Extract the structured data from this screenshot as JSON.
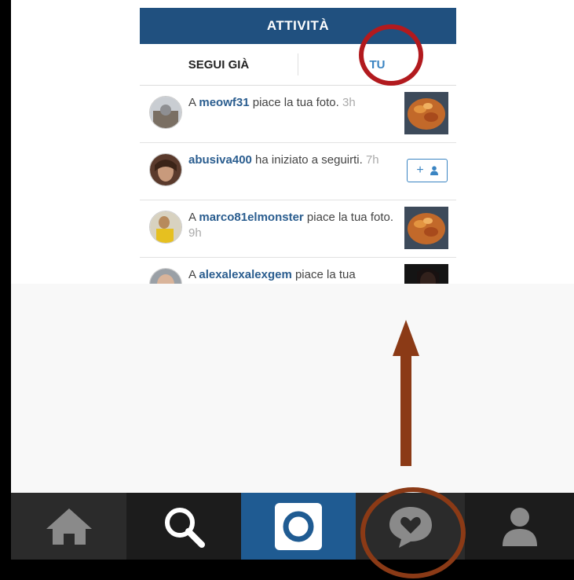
{
  "header": {
    "title": "ATTIVITÀ"
  },
  "tabs": [
    {
      "label": "SEGUI GIÀ"
    },
    {
      "label": "TU"
    }
  ],
  "feed": [
    {
      "prefix": "A ",
      "user": "meowf31",
      "action": " piace la tua foto. ",
      "time": "3h",
      "right": "photo"
    },
    {
      "prefix": "",
      "user": "abusiva400",
      "action": " ha iniziato a seguirti. ",
      "time": "7h",
      "right": "follow"
    },
    {
      "prefix": "A ",
      "user": "marco81elmonster",
      "action": " piace la tua foto. ",
      "time": "9h",
      "right": "photo"
    },
    {
      "prefix": "A ",
      "user": "alexalexalexgem",
      "action": " piace la tua",
      "time": "",
      "right": "photo-dark"
    }
  ],
  "follow_button": {
    "plus": "+",
    "icon": "person-icon"
  },
  "tabbar": {
    "items": [
      "home-icon",
      "search-icon",
      "camera-icon",
      "activity-heart-icon",
      "profile-icon"
    ],
    "selected": "camera-icon"
  },
  "colors": {
    "header": "#20507f",
    "link": "#2a5d8f",
    "active_tab": "#3a84c2",
    "annotation_red": "#b21a1e",
    "annotation_brown": "#8b3a16"
  }
}
